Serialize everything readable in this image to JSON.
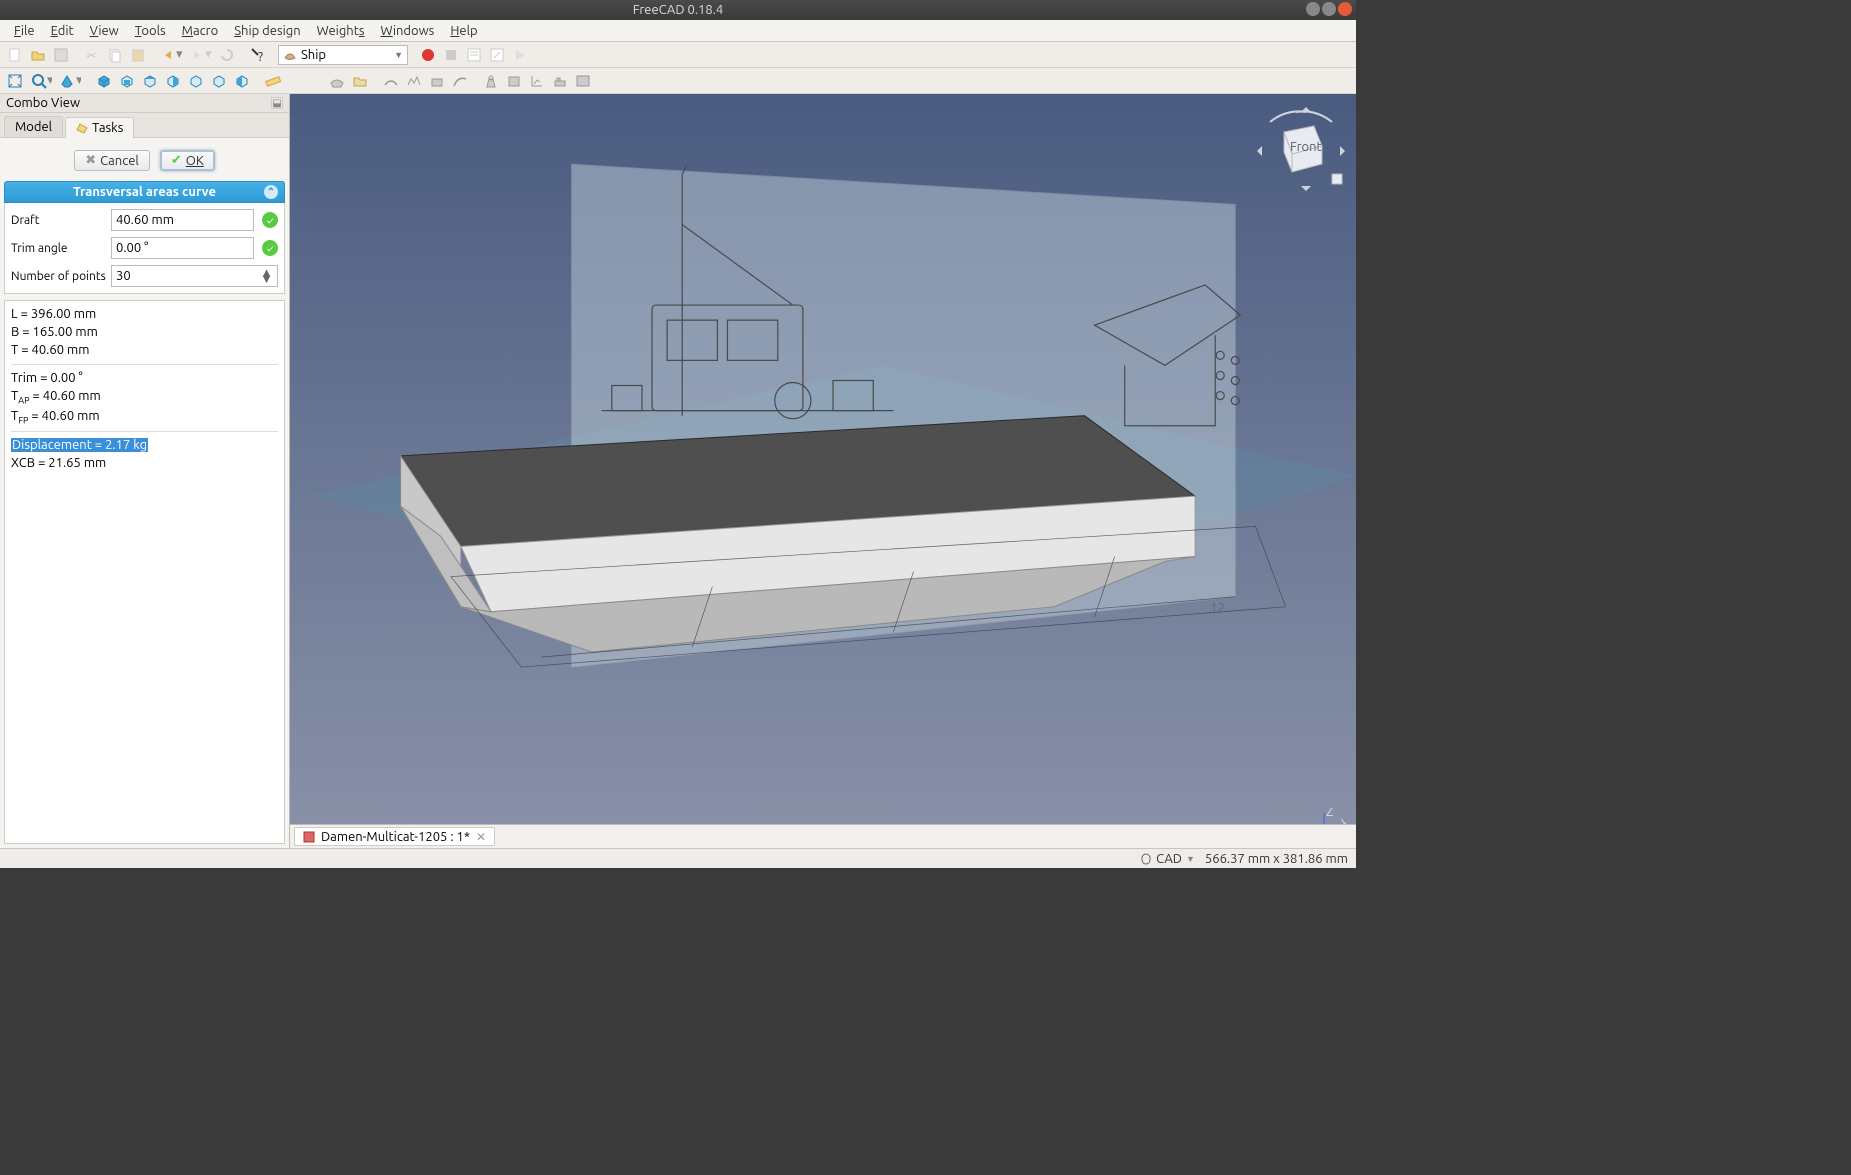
{
  "window": {
    "title": "FreeCAD 0.18.4"
  },
  "menu": {
    "file": "File",
    "edit": "Edit",
    "view": "View",
    "tools": "Tools",
    "macro": "Macro",
    "shipdesign": "Ship design",
    "weights": "Weights",
    "windows": "Windows",
    "help": "Help"
  },
  "workbench": {
    "label": "Ship"
  },
  "sidebar": {
    "title": "Combo View",
    "tabs": {
      "model": "Model",
      "tasks": "Tasks"
    },
    "buttons": {
      "cancel": "Cancel",
      "ok": "OK"
    }
  },
  "panel": {
    "title": "Transversal areas curve",
    "draft": {
      "label": "Draft",
      "value": "40.60 mm"
    },
    "trim": {
      "label": "Trim angle",
      "value": "0.00 °"
    },
    "points": {
      "label": "Number of points",
      "value": "30"
    }
  },
  "results": {
    "l": "L = 396.00 mm",
    "b": "B = 165.00 mm",
    "t": "T = 40.60 mm",
    "trim": "Trim = 0.00 °",
    "tap_pre": "T",
    "tap_sub": "AP",
    "tap_post": " = 40.60 mm",
    "tfp_pre": "T",
    "tfp_sub": "FP",
    "tfp_post": " = 40.60 mm",
    "disp": "Displacement = 2.17 kg",
    "xcb": "XCB = 21.65 mm"
  },
  "doctab": {
    "name": "Damen-Multicat-1205 : 1*"
  },
  "status": {
    "mode": "CAD",
    "coords": "566.37 mm x 381.86 mm"
  },
  "navcube": {
    "face": "Front"
  },
  "viewport_label": "12"
}
